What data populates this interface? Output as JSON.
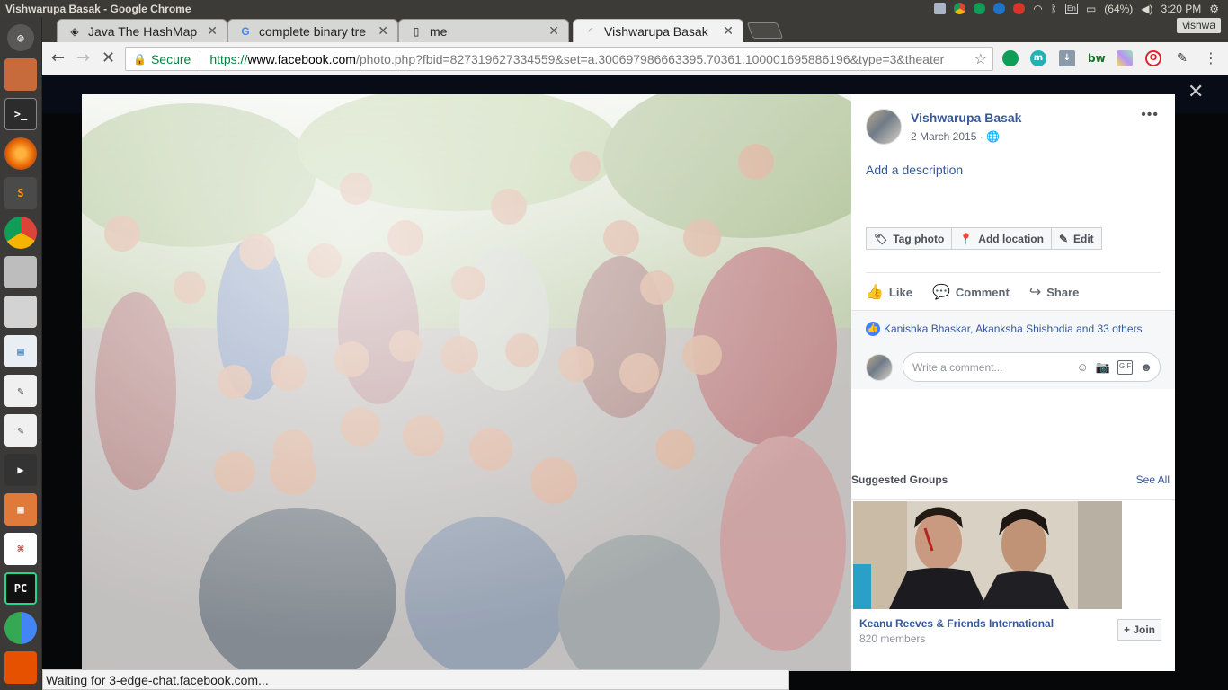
{
  "os": {
    "window_title": "Vishwarupa Basak - Google Chrome",
    "keyboard_layout": "En",
    "battery": "(64%)",
    "clock": "3:20 PM",
    "user_badge": "vishwa"
  },
  "launcher": {
    "icons": [
      "ubuntu-dash-icon",
      "files-icon",
      "terminal-icon",
      "firefox-icon",
      "sublime-text-icon",
      "chrome-icon",
      "drive-icon",
      "drive-icon",
      "document-viewer-icon",
      "text-editor-icon",
      "text-editor-icon",
      "video-player-icon",
      "presentation-icon",
      "pdf-reader-icon",
      "pycharm-icon",
      "chromium-icon",
      "software-updater-icon",
      "warning-icon"
    ]
  },
  "tabs": [
    {
      "title": "Java The HashMap",
      "favicon": "hashmap-icon"
    },
    {
      "title": "complete binary tre",
      "favicon": "google-icon"
    },
    {
      "title": "me",
      "favicon": "document-icon"
    },
    {
      "title": "Vishwarupa Basak",
      "favicon": "loading-icon",
      "active": true
    }
  ],
  "address_bar": {
    "secure_label": "Secure",
    "scheme": "https://",
    "host": "www.facebook.com",
    "path": "/photo.php?fbid=827319627334559&set=a.300697986663395.70361.100001695886196&type=3&theater"
  },
  "extensions": [
    {
      "name": "hangouts-icon",
      "color": "#0f9d58",
      "label": ""
    },
    {
      "name": "mendeley-icon",
      "color": "#21b3b3",
      "label": "m"
    },
    {
      "name": "download-icon",
      "color": "#8a9aa9",
      "label": "↓"
    },
    {
      "name": "bw-icon",
      "color": "#1a6f27",
      "label": "bw"
    },
    {
      "name": "color-picker-icon",
      "color": "#e8b8f0",
      "label": ""
    },
    {
      "name": "opera-icon",
      "color": "#e2222b",
      "label": "O"
    },
    {
      "name": "eyedropper-icon",
      "color": "#444444",
      "label": "✎"
    }
  ],
  "post": {
    "author": "Vishwarupa Basak",
    "date": "2 March 2015 ·",
    "add_description": "Add a description",
    "buttons": {
      "tag": "Tag photo",
      "location": "Add location",
      "edit": "Edit"
    },
    "actions": {
      "like": "Like",
      "comment": "Comment",
      "share": "Share"
    },
    "reactions": "Kanishka Bhaskar, Akanksha Shishodia and 33 others",
    "comment_placeholder": "Write a comment...",
    "comment_gif": "GIF"
  },
  "suggested": {
    "heading": "Suggested Groups",
    "see_all": "See All",
    "group_name": "Keanu Reeves & Friends International",
    "members": "820 members",
    "join": "Join"
  },
  "status_bar": "Waiting for 3-edge-chat.facebook.com...",
  "colors": {
    "facebook_blue": "#365899",
    "header_blue": "#233a6b",
    "chrome_green": "#0b8043"
  }
}
